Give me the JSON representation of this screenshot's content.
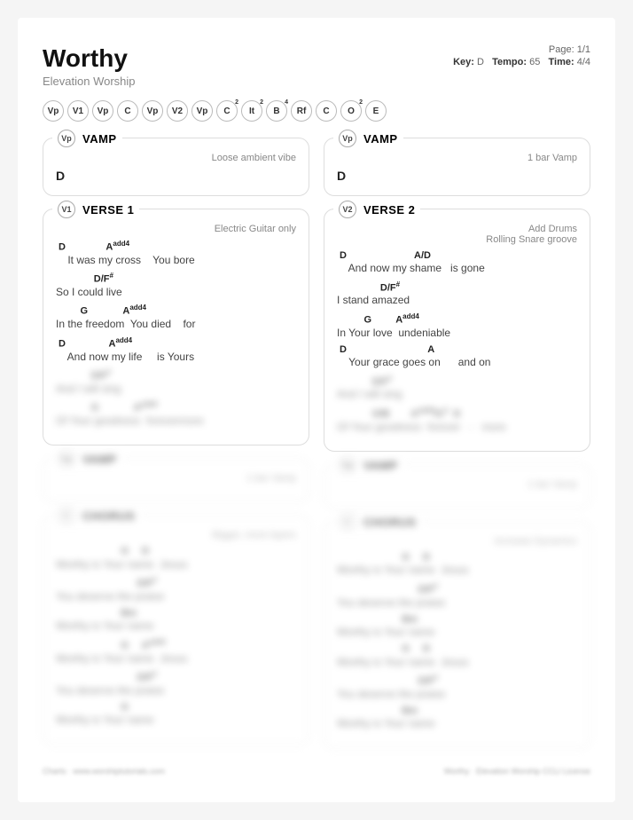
{
  "header": {
    "title": "Worthy",
    "artist": "Elevation Worship",
    "page": "Page: 1/1",
    "key_label": "Key:",
    "key": "D",
    "tempo_label": "Tempo:",
    "tempo": "65",
    "time_label": "Time:",
    "time": "4/4"
  },
  "nav": [
    {
      "label": "Vp"
    },
    {
      "label": "V1"
    },
    {
      "label": "Vp"
    },
    {
      "label": "C"
    },
    {
      "label": "Vp"
    },
    {
      "label": "V2"
    },
    {
      "label": "Vp"
    },
    {
      "label": "C",
      "sup": "2"
    },
    {
      "label": "It",
      "sup": "2"
    },
    {
      "label": "B",
      "sup": "4"
    },
    {
      "label": "Rf"
    },
    {
      "label": "C"
    },
    {
      "label": "O",
      "sup": "2"
    },
    {
      "label": "E"
    }
  ],
  "left": [
    {
      "badge": "Vp",
      "title": "VAMP",
      "note": "Loose ambient vibe",
      "solo": "D"
    },
    {
      "badge": "V1",
      "title": "VERSE 1",
      "note": "Electric Guitar only",
      "lines": [
        {
          "chords": " D               Aadd4",
          "lyric": "    It was my cross    You bore"
        },
        {
          "chords": "              D/F#",
          "lyric": "So I could live"
        },
        {
          "chords": "         G             Aadd4",
          "lyric": "In the freedom  You died    for"
        },
        {
          "chords": " D                Aadd4",
          "lyric": "    And now my life     is Yours"
        },
        {
          "chords": "             D/F#",
          "lyric": "And I will sing"
        },
        {
          "chords": "             G             Aadd4",
          "lyric": "Of Your goodness  forevermore"
        }
      ],
      "blur_from": 4
    },
    {
      "badge": "Vp",
      "title": "VAMP",
      "blurred": true,
      "note": "1 bar Vamp"
    },
    {
      "badge": "C",
      "title": "CHORUS",
      "blurred": true,
      "note": "Bigger, more layers",
      "lines": [
        {
          "chords": "                        G     D",
          "lyric": "Worthy is Your name  Jesus"
        },
        {
          "chords": "                              D/F#",
          "lyric": "You deserve the praise"
        },
        {
          "chords": "                        Bm",
          "lyric": "Worthy is Your name"
        },
        {
          "chords": "                        G     Aadd4",
          "lyric": "Worthy is Your name  Jesus"
        },
        {
          "chords": "                              D/F#",
          "lyric": "You deserve the praise"
        },
        {
          "chords": "                        G",
          "lyric": "Worthy is Your name"
        }
      ]
    }
  ],
  "right": [
    {
      "badge": "Vp",
      "title": "VAMP",
      "note": "1 bar Vamp",
      "solo": "D"
    },
    {
      "badge": "V2",
      "title": "VERSE 2",
      "note": "Add Drums\nRolling Snare groove",
      "lines": [
        {
          "chords": " D                         A/D",
          "lyric": "    And now my shame   is gone"
        },
        {
          "chords": "                D/F#",
          "lyric": "I stand amazed"
        },
        {
          "chords": "          G         Aadd4",
          "lyric": "In Your love  undeniable"
        },
        {
          "chords": " D                              A",
          "lyric": "    Your grace goes on      and on"
        },
        {
          "chords": "             D/F#",
          "lyric": "And I will sing"
        },
        {
          "chords": "             G/B        Aadd4/C#  D",
          "lyric": "Of Your goodness  forever   -   more"
        }
      ],
      "blur_from": 4
    },
    {
      "badge": "Vp",
      "title": "VAMP",
      "blurred": true,
      "note": "1 bar Vamp"
    },
    {
      "badge": "C",
      "title": "CHORUS",
      "blurred": true,
      "note": "Increase Dynamics",
      "lines": [
        {
          "chords": "                        G     D",
          "lyric": "Worthy is Your name  Jesus"
        },
        {
          "chords": "                              D/F#",
          "lyric": "You deserve the praise"
        },
        {
          "chords": "                        Bm",
          "lyric": "Worthy is Your name"
        },
        {
          "chords": "                        G     D",
          "lyric": "Worthy is Your name  Jesus"
        },
        {
          "chords": "                              D/F#",
          "lyric": "You deserve the praise"
        },
        {
          "chords": "                        Bm",
          "lyric": "Worthy is Your name"
        }
      ]
    }
  ],
  "footer": {
    "left": "Charts · www.worshiptutorials.com",
    "right": "Worthy · Elevation Worship\nCCLI License"
  }
}
